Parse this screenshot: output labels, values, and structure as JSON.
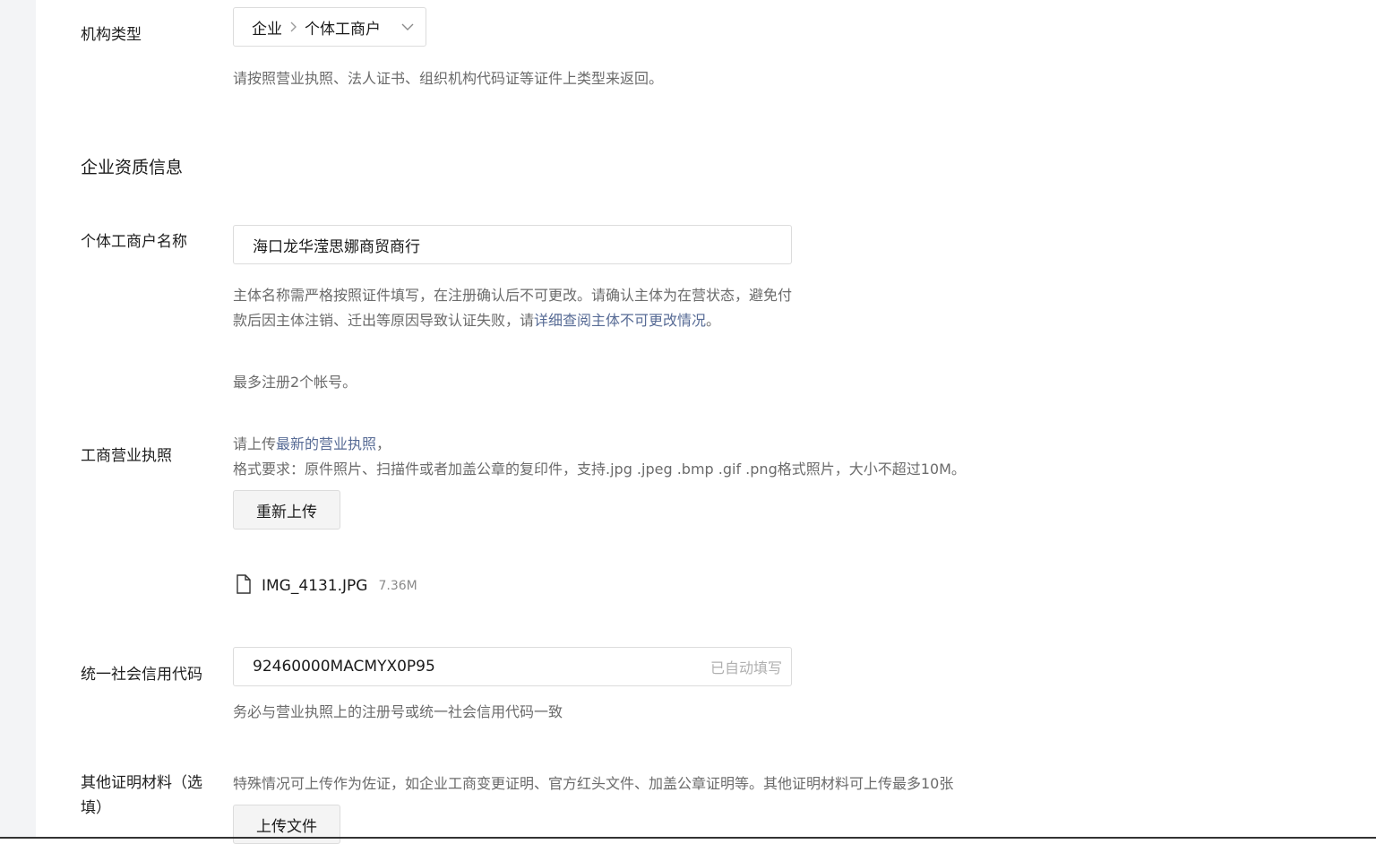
{
  "org_type": {
    "label": "机构类型",
    "select": {
      "level1": "企业",
      "level2": "个体工商户"
    },
    "hint": "请按照营业执照、法人证书、组织机构代码证等证件上类型来返回。"
  },
  "section_title": "企业资质信息",
  "biz_name": {
    "label": "个体工商户名称",
    "value": "海口龙华滢思娜商贸商行",
    "hint_part1": "主体名称需严格按照证件填写，在注册确认后不可更改。请确认主体为在营状态，避免付款后因主体注销、迁出等原因导致认证失败，请",
    "hint_link": "详细查阅主体不可更改情况",
    "hint_part2": "。",
    "limit": "最多注册2个帐号。"
  },
  "license": {
    "label": "工商营业执照",
    "line1_prefix": "请上传",
    "line1_link": "最新的营业执照",
    "line1_suffix": "，",
    "line2": "格式要求：原件照片、扫描件或者加盖公章的复印件，支持.jpg .jpeg .bmp .gif .png格式照片，大小不超过10M。",
    "reupload_button": "重新上传",
    "file_icon": "file-icon",
    "file_name": "IMG_4131.JPG",
    "file_size": "7.36M"
  },
  "credit_code": {
    "label": "统一社会信用代码",
    "value": "92460000MACMYX0P95",
    "suffix": "已自动填写",
    "hint": "务必与营业执照上的注册号或统一社会信用代码一致"
  },
  "other_docs": {
    "label_line1": "其他证明材料（选",
    "label_line2": "填）",
    "hint": "特殊情况可上传作为佐证，如企业工商变更证明、官方红头文件、加盖公章证明等。其他证明材料可上传最多10张",
    "upload_button": "上传文件"
  }
}
